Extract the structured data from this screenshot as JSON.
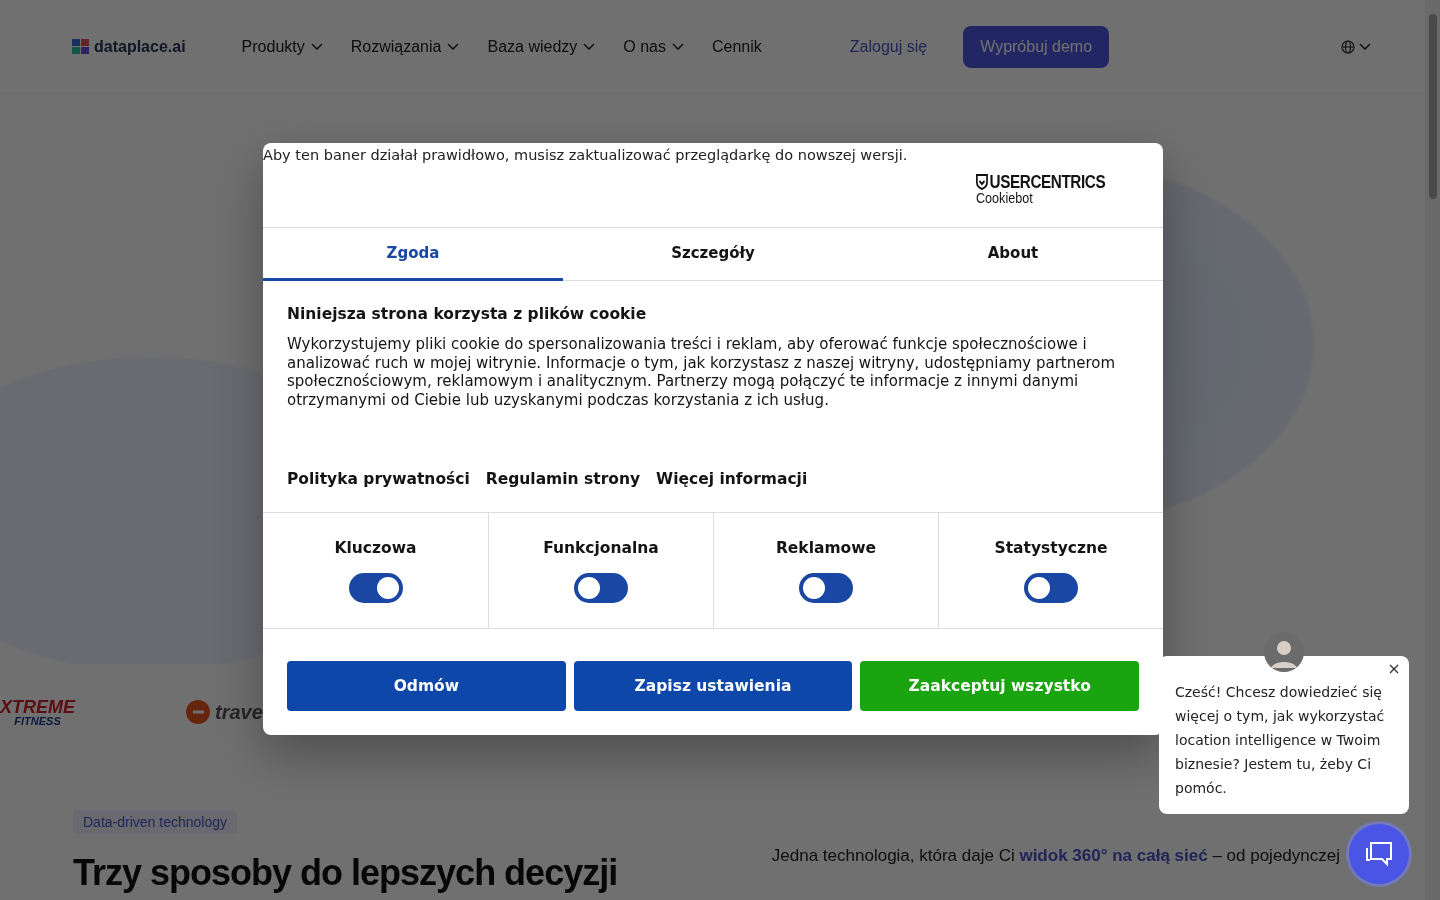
{
  "header": {
    "logo": "dataplace.ai",
    "nav": [
      {
        "label": "Produkty",
        "dropdown": true
      },
      {
        "label": "Rozwiązania",
        "dropdown": true
      },
      {
        "label": "Baza wiedzy",
        "dropdown": true
      },
      {
        "label": "O nas",
        "dropdown": true
      },
      {
        "label": "Cennik",
        "dropdown": false
      }
    ],
    "login": "Zaloguj się",
    "demo": "Wypróbuj demo"
  },
  "logos": [
    {
      "lines": [
        "XTREME",
        "FITNESS"
      ]
    },
    {
      "lines": [
        "trave"
      ]
    }
  ],
  "section": {
    "tag": "Data-driven technology",
    "heading": "Trzy sposoby do lepszych decyzji",
    "lead": "Jedna technologia, która daje Ci **widok 360° na całą sieć** – od pojedynczej"
  },
  "cookie_banner": {
    "notice": "Aby ten baner działał prawidłowo, musisz zaktualizować przeglądarkę do nowszej wersji.",
    "brand": {
      "name": "USERCENTRICS",
      "product": "Cookiebot"
    },
    "tabs": [
      {
        "label": "Zgoda",
        "selected": true
      },
      {
        "label": "Szczegóły",
        "selected": false
      },
      {
        "label": "About",
        "selected": false
      }
    ],
    "title": "Niniejsza strona korzysta z plików cookie",
    "body": "Wykorzystujemy pliki cookie do spersonalizowania treści i reklam, aby oferować funkcje społecznościowe i analizować ruch w mojej witrynie. Informacje o tym, jak korzystasz z naszej witryny, udostępniamy partnerom społecznościowym, reklamowym i analitycznym. Partnerzy mogą połączyć te informacje z innymi danymi otrzymanymi od Ciebie lub uzyskanymi podczas korzystania z ich usług.",
    "links": [
      "Polityka prywatności",
      "Regulamin strony",
      "Więcej informacji"
    ],
    "categories": [
      {
        "label": "Kluczowa",
        "on": true
      },
      {
        "label": "Funkcjonalna",
        "on": false
      },
      {
        "label": "Reklamowe",
        "on": false
      },
      {
        "label": "Statystyczne",
        "on": false
      }
    ],
    "buttons": [
      {
        "label": "Odmów",
        "kind": "secondary"
      },
      {
        "label": "Zapisz ustawienia",
        "kind": "secondary"
      },
      {
        "label": "Zaakceptuj wszystko",
        "kind": "primary"
      }
    ]
  },
  "chat": {
    "message": "Cześć! Chcesz dowiedzieć się więcej o tym, jak wykorzystać location intelligence w Twoim biznesie? Jestem tu, żeby Ci pomóc."
  }
}
